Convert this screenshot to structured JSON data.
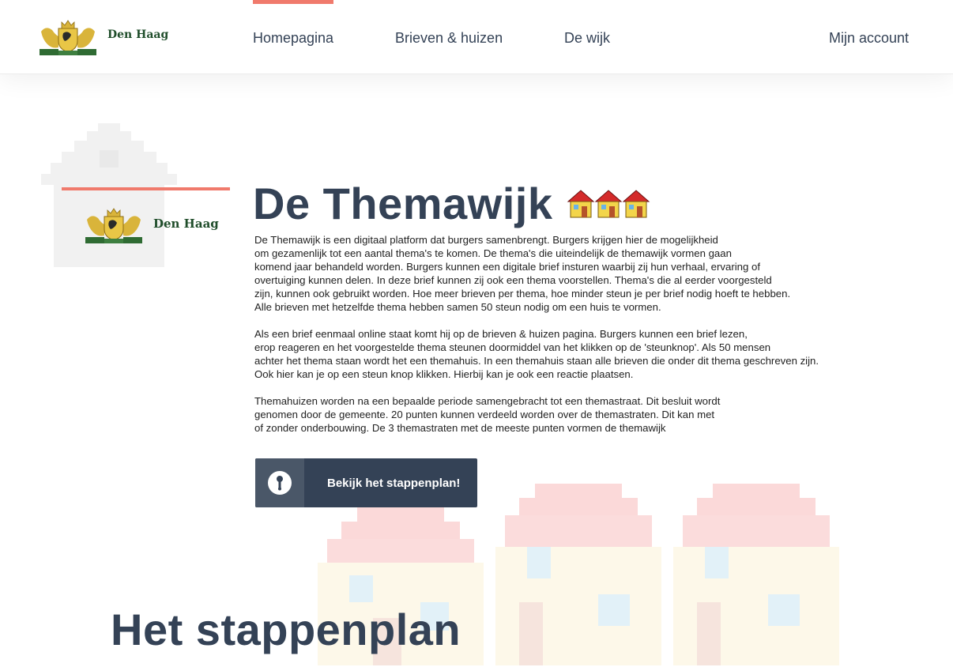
{
  "header": {
    "brand_name": "Den Haag",
    "nav": [
      {
        "label": "Homepagina",
        "active": true
      },
      {
        "label": "Brieven & huizen",
        "active": false
      },
      {
        "label": "De wijk",
        "active": false
      }
    ],
    "account_label": "Mijn account"
  },
  "sidebar": {
    "brand_name": "Den Haag"
  },
  "main": {
    "title": "De Themawijk",
    "title_icon": "three-houses-icon",
    "paragraphs": [
      "De Themawijk is een digitaal platform dat burgers samenbrengt. Burgers krijgen hier de mogelijkheid\nom gezamenlijk tot een aantal thema's te komen. De thema's die uiteindelijk de themawijk vormen gaan\nkomend jaar behandeld worden. Burgers kunnen een digitale brief insturen waarbij zij hun verhaal, ervaring of\novertuiging kunnen delen. In deze brief kunnen zij ook een thema voorstellen. Thema's die al eerder voorgesteld\nzijn, kunnen ook gebruikt worden. Hoe meer brieven per thema, hoe minder steun je per brief nodig hoeft te hebben.\nAlle brieven met hetzelfde thema hebben samen 50 steun nodig om een huis te vormen.",
      "Als een brief eenmaal online staat komt hij op de brieven & huizen pagina. Burgers kunnen een brief lezen,\nerop reageren en het voorgestelde thema steunen doormiddel van het klikken op de 'steunknop'. Als 50 mensen\nachter het thema staan wordt het een themahuis. In een themahuis staan alle brieven die onder dit thema geschreven zijn.\nOok hier kan je op een steun knop klikken. Hierbij kan je ook een reactie plaatsen.",
      "Themahuizen worden na een bepaalde periode samengebracht tot een themastraat. Dit besluit wordt\ngenomen door de gemeente. 20 punten kunnen verdeeld worden over de themastraten. Dit kan met\nof zonder onderbouwing. De 3 themastraten met de meeste punten vormen de themawijk"
    ],
    "cta_label": "Bekijk het stappenplan!",
    "cta_icon": "info-icon"
  },
  "section": {
    "title": "Het stappenplan"
  },
  "colors": {
    "primary": "#344256",
    "accent": "#f07a6c",
    "brand_green": "#1f4d2a"
  }
}
